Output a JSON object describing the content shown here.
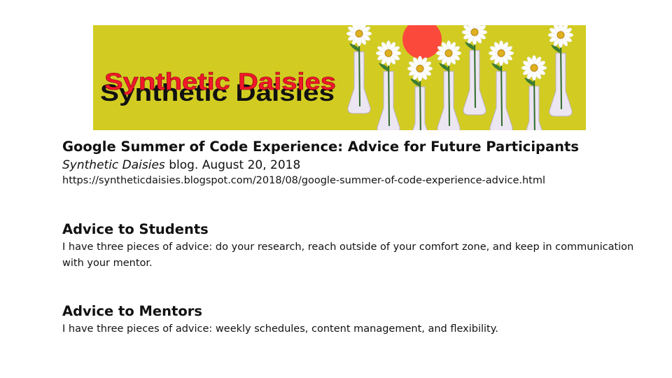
{
  "banner": {
    "logo_text": "Synthetic Daisies",
    "colors": {
      "background": "#d2cc22",
      "logo_red": "#f2182a",
      "logo_shadow": "#111111",
      "sun": "#fb4a3c"
    }
  },
  "post": {
    "title": "Google Summer of Code Experience: Advice for Future Participants",
    "blog_name": "Synthetic Daisies",
    "citation_rest": " blog. August 20, 2018",
    "url": "https://syntheticdaisies.blogspot.com/2018/08/google-summer-of-code-experience-advice.html"
  },
  "sections": [
    {
      "heading": "Advice to Students",
      "body": "I have three pieces of advice: do your research, reach outside of your comfort zone, and keep in communication with your mentor."
    },
    {
      "heading": "Advice to Mentors",
      "body": "I have three pieces of advice: weekly schedules, content management, and flexibility."
    }
  ]
}
